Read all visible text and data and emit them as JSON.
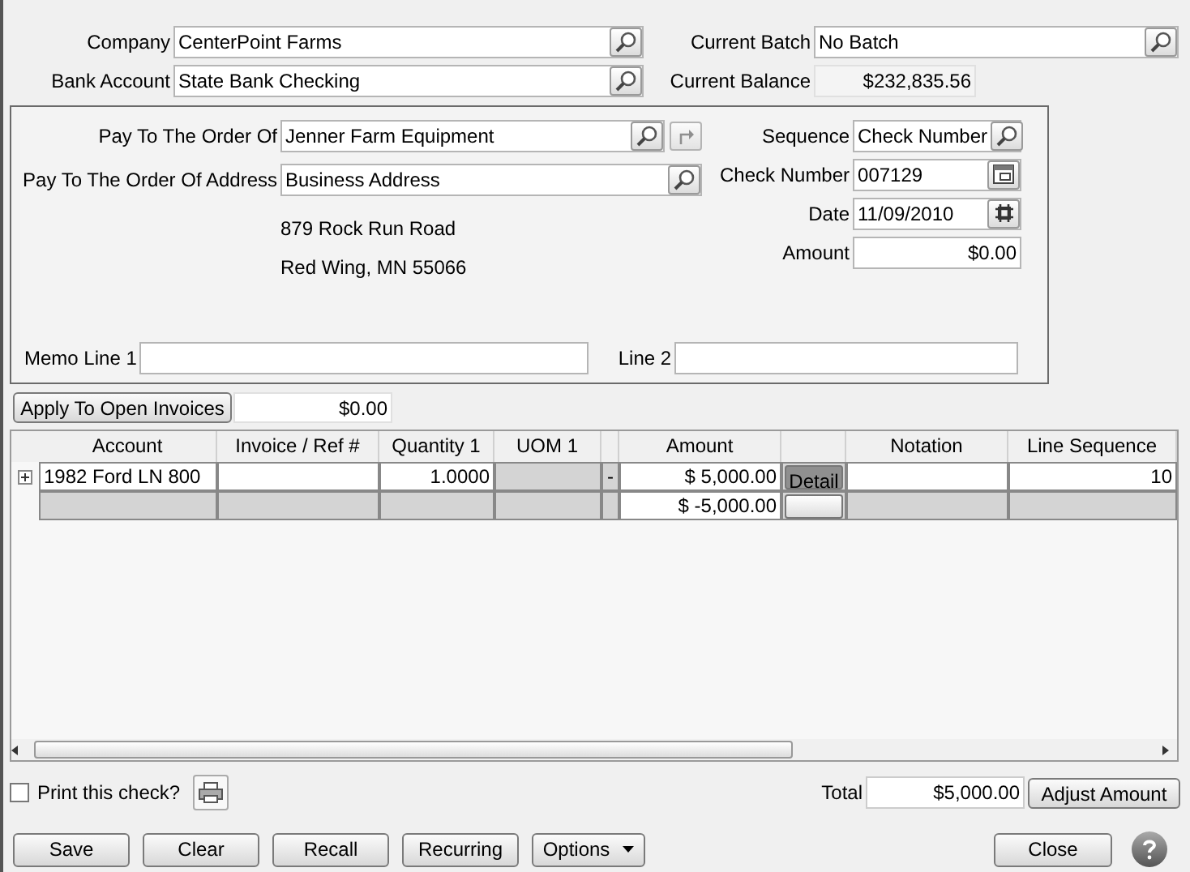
{
  "header": {
    "company": {
      "label": "Company",
      "value": "CenterPoint Farms"
    },
    "bank_account": {
      "label": "Bank Account",
      "value": "State Bank Checking"
    },
    "current_batch": {
      "label": "Current Batch",
      "value": "No Batch"
    },
    "current_balance": {
      "label": "Current Balance",
      "value": "$232,835.56"
    }
  },
  "payee": {
    "pay_to": {
      "label": "Pay To The Order Of",
      "value": "Jenner Farm Equipment"
    },
    "address": {
      "label": "Pay To The Order Of Address",
      "value": "Business Address"
    },
    "address_lines": [
      "879 Rock Run Road",
      "Red Wing, MN  55066"
    ],
    "sequence": {
      "label": "Sequence",
      "value": "Check Number"
    },
    "check_number": {
      "label": "Check Number",
      "value": "007129"
    },
    "date": {
      "label": "Date",
      "value": "11/09/2010"
    },
    "amount": {
      "label": "Amount",
      "value": "$0.00"
    },
    "memo1": {
      "label": "Memo Line 1"
    },
    "memo2": {
      "label": "Line 2"
    }
  },
  "apply": {
    "button": "Apply To Open Invoices",
    "value": "$0.00"
  },
  "table": {
    "columns": [
      "Account",
      "Invoice / Ref #",
      "Quantity 1",
      "UOM 1",
      "Amount",
      "Notation",
      "Line Sequence"
    ],
    "rows": [
      {
        "kind": "entry",
        "expandable": true,
        "account": "1982 Ford LN 800",
        "quantity": "1.0000",
        "separator": "-",
        "amount": "$ 5,000.00",
        "detail": "Detail",
        "line_sequence": "10"
      },
      {
        "kind": "summary",
        "expandable": false,
        "amount": "$ -5,000.00"
      }
    ]
  },
  "print": {
    "label": "Print this check?",
    "checked": false
  },
  "total": {
    "label": "Total",
    "value": "$5,000.00",
    "button": "Adjust Amount"
  },
  "buttons": [
    {
      "label": "Save",
      "kind": "plain"
    },
    {
      "label": "Clear",
      "kind": "plain"
    },
    {
      "label": "Recall",
      "kind": "plain"
    },
    {
      "label": "Recurring",
      "kind": "plain"
    },
    {
      "label": "Options",
      "kind": "menu"
    }
  ],
  "close": "Close"
}
